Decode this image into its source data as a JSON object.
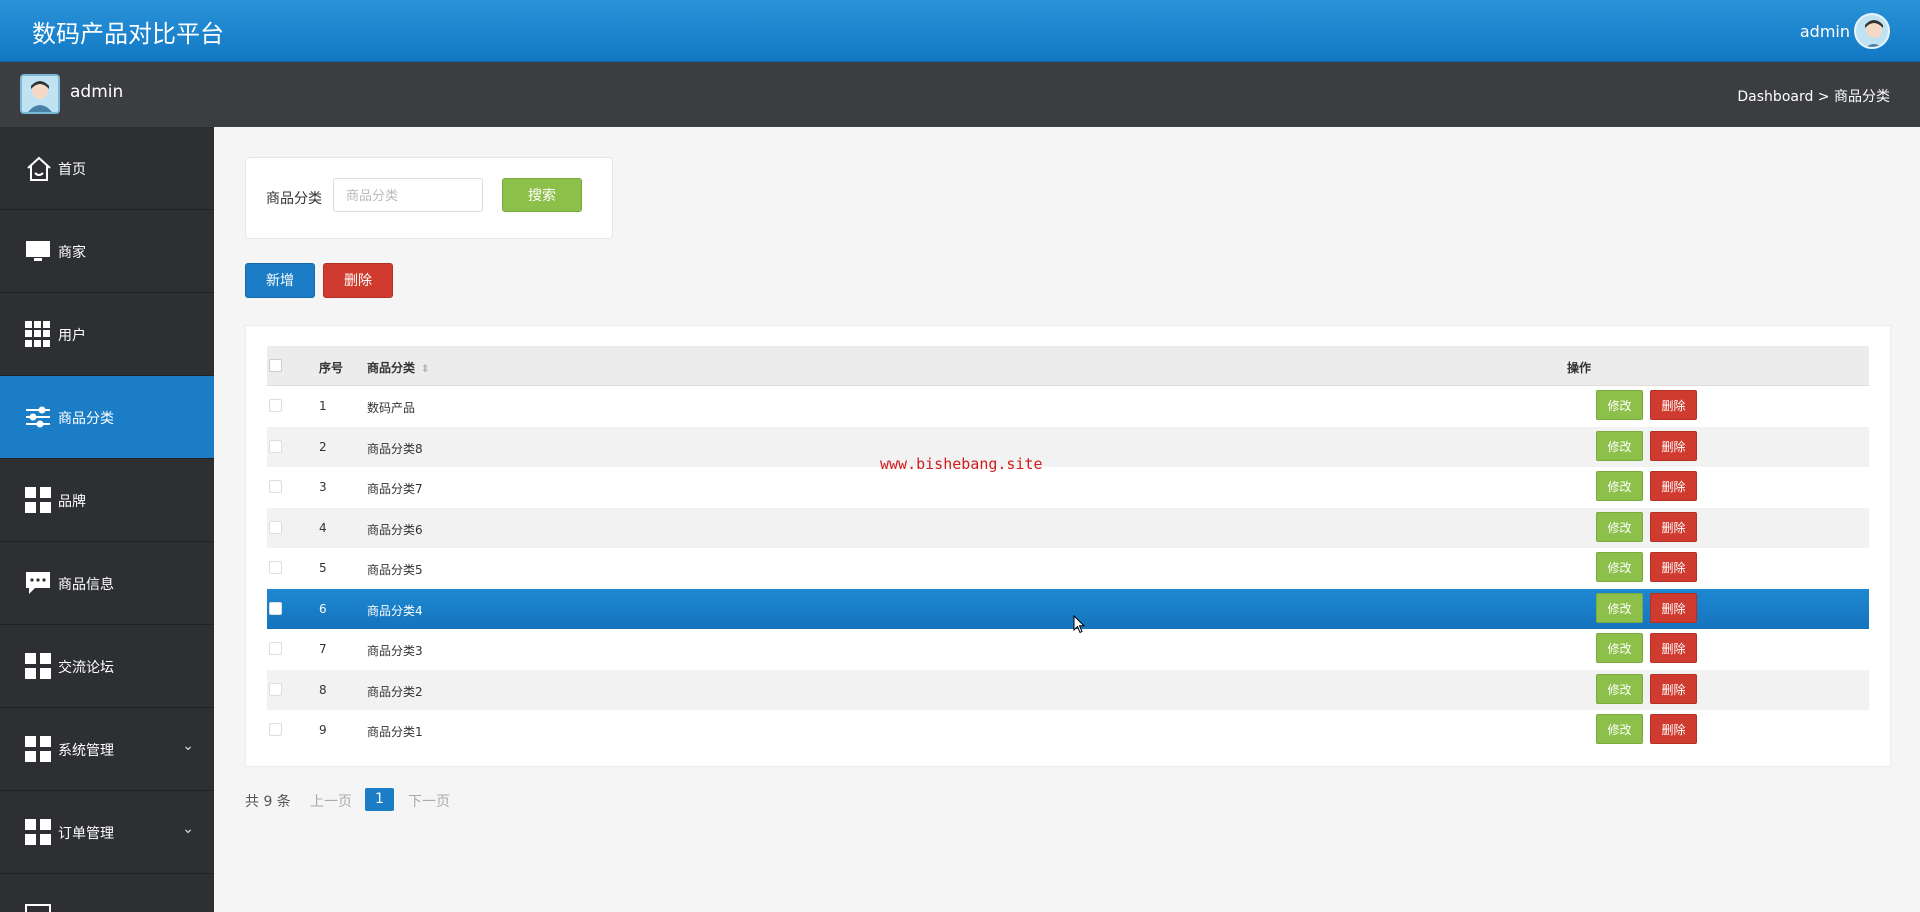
{
  "header": {
    "app_title": "数码产品对比平台",
    "user": "admin"
  },
  "subbar": {
    "user": "admin",
    "breadcrumb": "Dashboard > 商品分类"
  },
  "sidebar": {
    "items": [
      {
        "label": "首页",
        "icon": "home-icon"
      },
      {
        "label": "商家",
        "icon": "monitor-icon"
      },
      {
        "label": "用户",
        "icon": "grid-icon"
      },
      {
        "label": "商品分类",
        "icon": "sliders-icon",
        "active": true
      },
      {
        "label": "品牌",
        "icon": "grid-icon"
      },
      {
        "label": "商品信息",
        "icon": "chat-icon"
      },
      {
        "label": "交流论坛",
        "icon": "grid-icon"
      },
      {
        "label": "系统管理",
        "icon": "grid-icon",
        "expandable": true
      },
      {
        "label": "订单管理",
        "icon": "grid-icon",
        "expandable": true
      }
    ]
  },
  "search": {
    "label": "商品分类",
    "placeholder": "商品分类",
    "value": "",
    "button": "搜索"
  },
  "toolbar": {
    "add": "新增",
    "delete": "删除"
  },
  "table": {
    "headers": {
      "no": "序号",
      "name": "商品分类",
      "ops": "操作"
    },
    "rows": [
      {
        "no": "1",
        "name": "数码产品"
      },
      {
        "no": "2",
        "name": "商品分类8"
      },
      {
        "no": "3",
        "name": "商品分类7"
      },
      {
        "no": "4",
        "name": "商品分类6"
      },
      {
        "no": "5",
        "name": "商品分类5"
      },
      {
        "no": "6",
        "name": "商品分类4",
        "selected": true
      },
      {
        "no": "7",
        "name": "商品分类3"
      },
      {
        "no": "8",
        "name": "商品分类2"
      },
      {
        "no": "9",
        "name": "商品分类1"
      }
    ],
    "edit_label": "修改",
    "delete_label": "删除"
  },
  "watermark": "www.bishebang.site",
  "pagination": {
    "total": "共 9 条",
    "prev": "上一页",
    "current": "1",
    "next": "下一页"
  },
  "colors": {
    "primary": "#1a7dc6",
    "success": "#8dc04a",
    "danger": "#cf3b2e",
    "sidebar": "#2d2f32"
  }
}
